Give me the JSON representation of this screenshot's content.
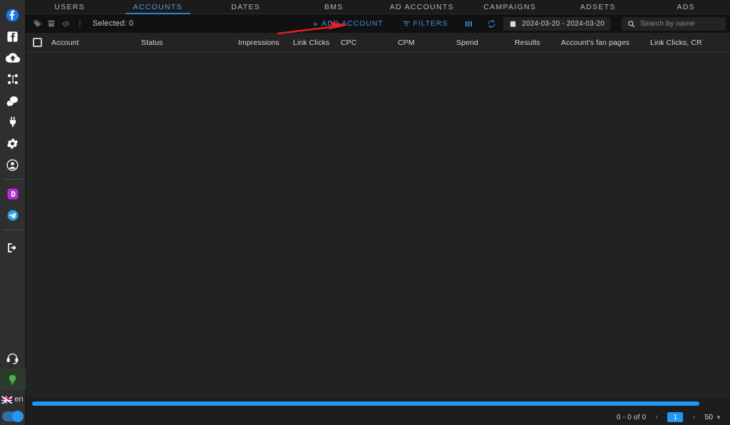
{
  "sidebar": {
    "items": [
      {
        "name": "facebook-round-icon",
        "label": "Facebook"
      },
      {
        "name": "facebook-square-icon",
        "label": "Facebook Page"
      },
      {
        "name": "cloud-upload-icon",
        "label": "Upload"
      },
      {
        "name": "sitemap-icon",
        "label": "Structure"
      },
      {
        "name": "chat-icon",
        "label": "Messages"
      },
      {
        "name": "plug-icon",
        "label": "Integrations"
      },
      {
        "name": "gear-icon",
        "label": "Settings"
      },
      {
        "name": "account-circle-icon",
        "label": "Profile"
      },
      {
        "name": "video-app-icon",
        "label": "Media"
      },
      {
        "name": "telegram-icon",
        "label": "Telegram"
      },
      {
        "name": "logout-icon",
        "label": "Logout"
      },
      {
        "name": "support-headset-icon",
        "label": "Support"
      },
      {
        "name": "lightbulb-icon",
        "label": "Tips"
      }
    ],
    "language": "en",
    "theme_toggle": "dark"
  },
  "tabs": [
    {
      "label": "USERS",
      "active": false
    },
    {
      "label": "ACCOUNTS",
      "active": true
    },
    {
      "label": "DATES",
      "active": false
    },
    {
      "label": "BMS",
      "active": false
    },
    {
      "label": "AD ACCOUNTS",
      "active": false
    },
    {
      "label": "CAMPAIGNS",
      "active": false
    },
    {
      "label": "ADSETS",
      "active": false
    },
    {
      "label": "ADS",
      "active": false
    }
  ],
  "toolbar": {
    "icons": [
      {
        "name": "tag-icon"
      },
      {
        "name": "archive-icon"
      },
      {
        "name": "code-icon"
      },
      {
        "name": "more-vertical-icon"
      }
    ],
    "selected_text": "Selected: 0",
    "add_account_label": "ADD ACCOUNT",
    "filters_label": "FILTERS",
    "columns_icon": "columns-icon",
    "refresh_icon": "refresh-icon",
    "date_range": "2024-03-20 - 2024-03-20",
    "search_placeholder": "Search by name",
    "search_value": ""
  },
  "table": {
    "columns": [
      "Account",
      "Status",
      "Impressions",
      "Link Clicks",
      "CPC",
      "CPM",
      "Spend",
      "Results",
      "Account's fan pages",
      "Link Clicks, CR"
    ],
    "rows": []
  },
  "footer": {
    "range_text": "0 - 0 of 0",
    "prev_icon": "chevron-left-icon",
    "next_icon": "chevron-right-icon",
    "current_page": "1",
    "page_size": "50",
    "caret_icon": "caret-down-icon"
  },
  "annotation": {
    "type": "arrow",
    "color": "#e81f1f",
    "points_to": "ADD ACCOUNT"
  },
  "colors": {
    "accent_blue": "#2196f3",
    "tab_active": "#4a9fe0",
    "toolbar_bg": "#111111",
    "table_bg": "#222222",
    "sidebar_bg": "#2f2f2f",
    "annotation_red": "#e81f1f"
  }
}
